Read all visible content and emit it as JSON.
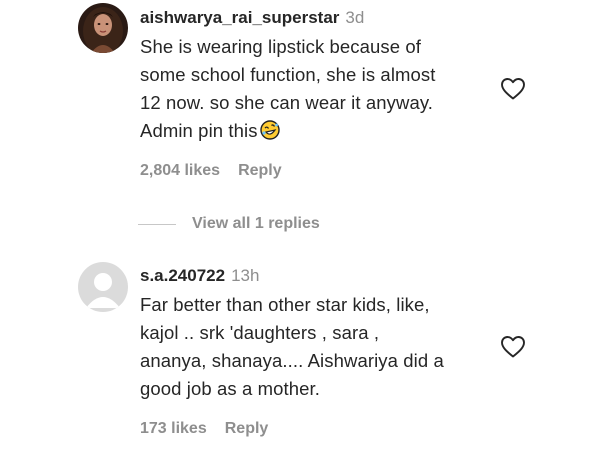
{
  "comments": [
    {
      "username": "aishwarya_rai_superstar",
      "time": "3d",
      "lines": [
        "She is wearing lipstick because of",
        "some school function, she is almost",
        "12 now. so she can wear it anyway.",
        "Admin pin this"
      ],
      "emoji": "rolling-on-floor-laughing-emoji",
      "likes": "2,804 likes",
      "reply": "Reply",
      "liked": false
    },
    {
      "username": "s.a.240722",
      "time": "13h",
      "lines": [
        "Far better than other star kids, like,",
        "kajol .. srk 'daughters , sara ,",
        "ananya, shanaya.... Aishwariya did a",
        "good job as a mother."
      ],
      "likes": "173 likes",
      "reply": "Reply",
      "liked": false
    }
  ],
  "view_replies": "View all 1 replies",
  "colors": {
    "text": "#262626",
    "secondary": "#8e8e8e",
    "divider": "#c7c7c7"
  }
}
